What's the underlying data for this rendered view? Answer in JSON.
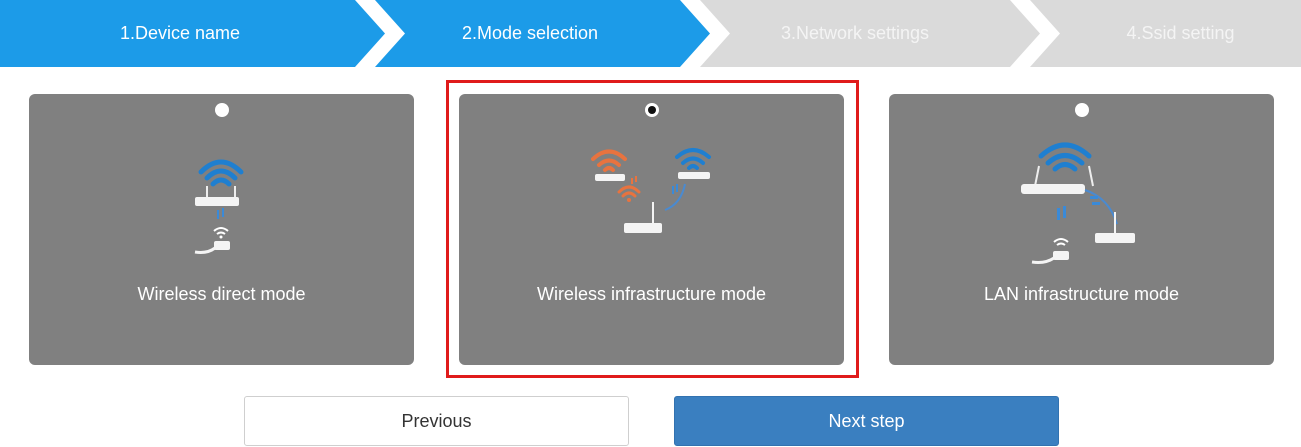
{
  "steps": [
    {
      "label": "1.Device name",
      "state": "done"
    },
    {
      "label": "2.Mode selection",
      "state": "current"
    },
    {
      "label": "3.Network settings",
      "state": "pending"
    },
    {
      "label": "4.Ssid setting",
      "state": "pending"
    }
  ],
  "modes": [
    {
      "label": "Wireless direct mode",
      "selected": false
    },
    {
      "label": "Wireless infrastructure mode",
      "selected": true
    },
    {
      "label": "LAN infrastructure mode",
      "selected": false
    }
  ],
  "buttons": {
    "previous": "Previous",
    "next": "Next step"
  },
  "colors": {
    "step_active": "#1c9be8",
    "step_inactive": "#dadada",
    "card_bg": "#808080",
    "selection_border": "#e01b1b",
    "next_button": "#3a7fc0"
  }
}
